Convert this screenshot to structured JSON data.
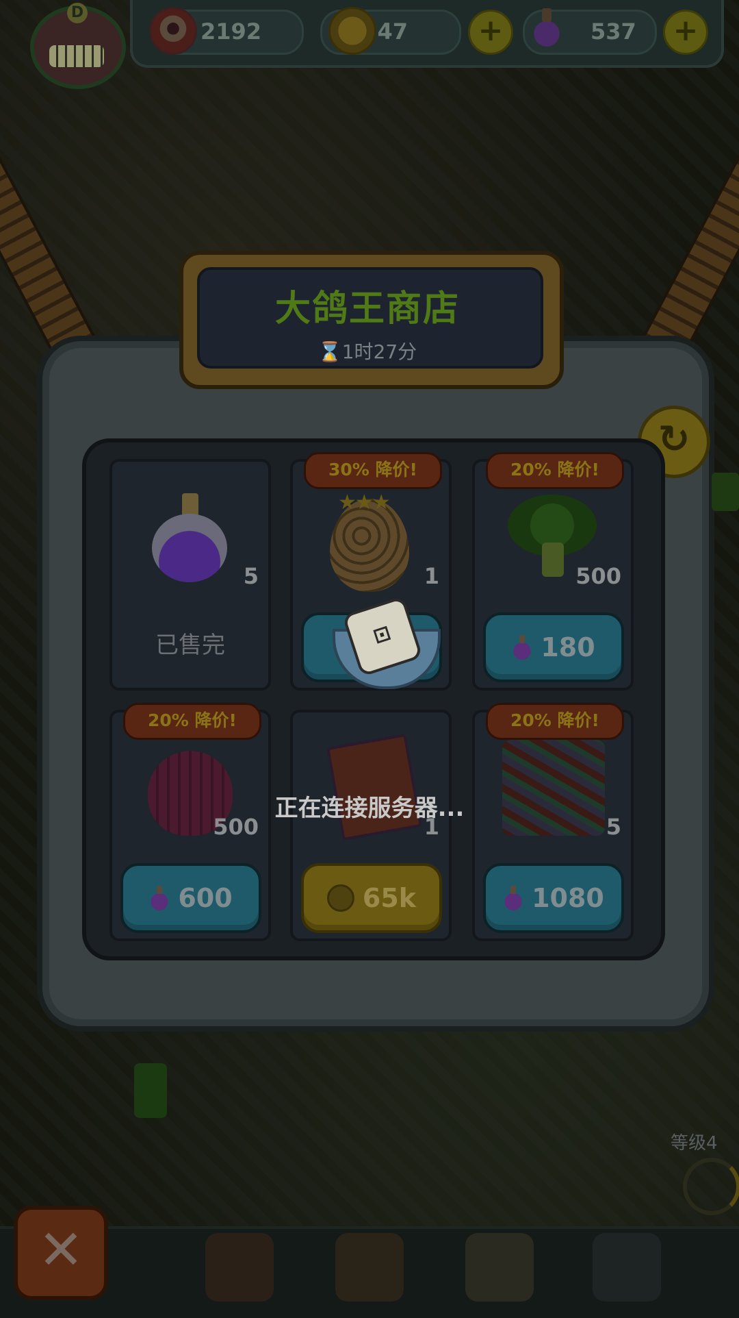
{
  "hud": {
    "eyes_value": "2192",
    "coins_value": "7347",
    "potions_value": "537",
    "plus_label": "+",
    "avatar_letter": "D"
  },
  "shop": {
    "title": "大鸽王商店",
    "timer": "⌛1时27分",
    "refresh_icon": "↻",
    "items": [
      {
        "badge": "",
        "qty": "5",
        "price": "",
        "currency": "potion",
        "status": "已售完"
      },
      {
        "badge": "30% 降价!",
        "qty": "1",
        "price": "",
        "currency": "potion",
        "status": ""
      },
      {
        "badge": "20% 降价!",
        "qty": "500",
        "price": "180",
        "currency": "potion",
        "status": ""
      },
      {
        "badge": "20% 降价!",
        "qty": "500",
        "price": "600",
        "currency": "potion",
        "status": ""
      },
      {
        "badge": "",
        "qty": "1",
        "price": "65k",
        "currency": "coin",
        "status": ""
      },
      {
        "badge": "20% 降价!",
        "qty": "5",
        "price": "1080",
        "currency": "potion",
        "status": ""
      }
    ]
  },
  "loading": {
    "text": "正在连接服务器...",
    "dice_face": "⊡"
  },
  "bottom": {
    "close_label": "✕",
    "level": "等级4"
  },
  "colors": {
    "accent_green": "#4f7a16",
    "button_blue": "#1f5a6a",
    "button_gold": "#6a5a12",
    "badge_red": "#5a2614"
  }
}
